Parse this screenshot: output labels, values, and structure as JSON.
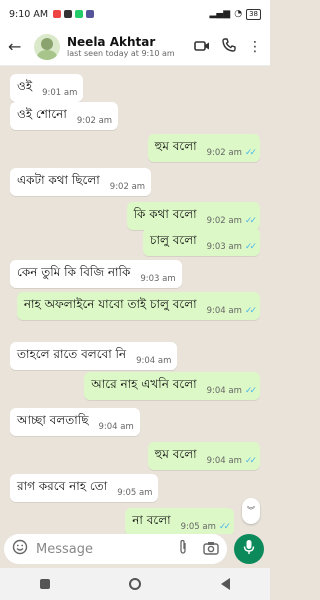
{
  "status_bar": {
    "time": "9:10 AM",
    "signal": "signal",
    "battery": "38"
  },
  "header": {
    "back_icon": "arrow-left-icon",
    "contact_name": "Neela Akhtar",
    "last_seen": "last seen today at 9:10 am",
    "video_icon": "video-call-icon",
    "call_icon": "phone-icon",
    "menu_icon": "more-vert-icon"
  },
  "messages": [
    {
      "dir": "in",
      "text": "ওই",
      "time": "9:01 am"
    },
    {
      "dir": "in",
      "text": "ওই শোনো",
      "time": "9:02 am"
    },
    {
      "dir": "out",
      "text": "হুম বলো",
      "time": "9:02 am",
      "read": true
    },
    {
      "dir": "in",
      "text": "একটা কথা ছিলো",
      "time": "9:02 am"
    },
    {
      "dir": "out",
      "text": "কি কথা বলো",
      "time": "9:02 am",
      "read": true
    },
    {
      "dir": "out",
      "text": "চালু বলো",
      "time": "9:03 am",
      "read": true
    },
    {
      "dir": "in",
      "text": "কেন তুমি কি বিজি নাকি",
      "time": "9:03 am"
    },
    {
      "dir": "out",
      "text": "নাহ অফলাইনে যাবো তাই চালু বলো",
      "time": "9:04 am",
      "read": true
    },
    {
      "dir": "in",
      "text": "তাহলে রাতে বলবো নি",
      "time": "9:04 am"
    },
    {
      "dir": "out",
      "text": "আরে নাহ এখনি বলো",
      "time": "9:04 am",
      "read": true
    },
    {
      "dir": "in",
      "text": "আচ্ছা বলতাছি",
      "time": "9:04 am"
    },
    {
      "dir": "out",
      "text": "হুম বলো",
      "time": "9:04 am",
      "read": true
    },
    {
      "dir": "in",
      "text": "রাগ করবে নাহ তো",
      "time": "9:05 am"
    },
    {
      "dir": "out",
      "text": "না বলো",
      "time": "9:05 am",
      "read": true
    }
  ],
  "composer": {
    "placeholder": "Message",
    "emoji_icon": "emoji-icon",
    "attach_icon": "paperclip-icon",
    "camera_icon": "camera-icon",
    "mic_icon": "mic-icon"
  },
  "colors": {
    "incoming": "#ffffff",
    "outgoing": "#dcf8c6",
    "accent": "#0d8a5c",
    "read_ticks": "#4fb6ec"
  }
}
